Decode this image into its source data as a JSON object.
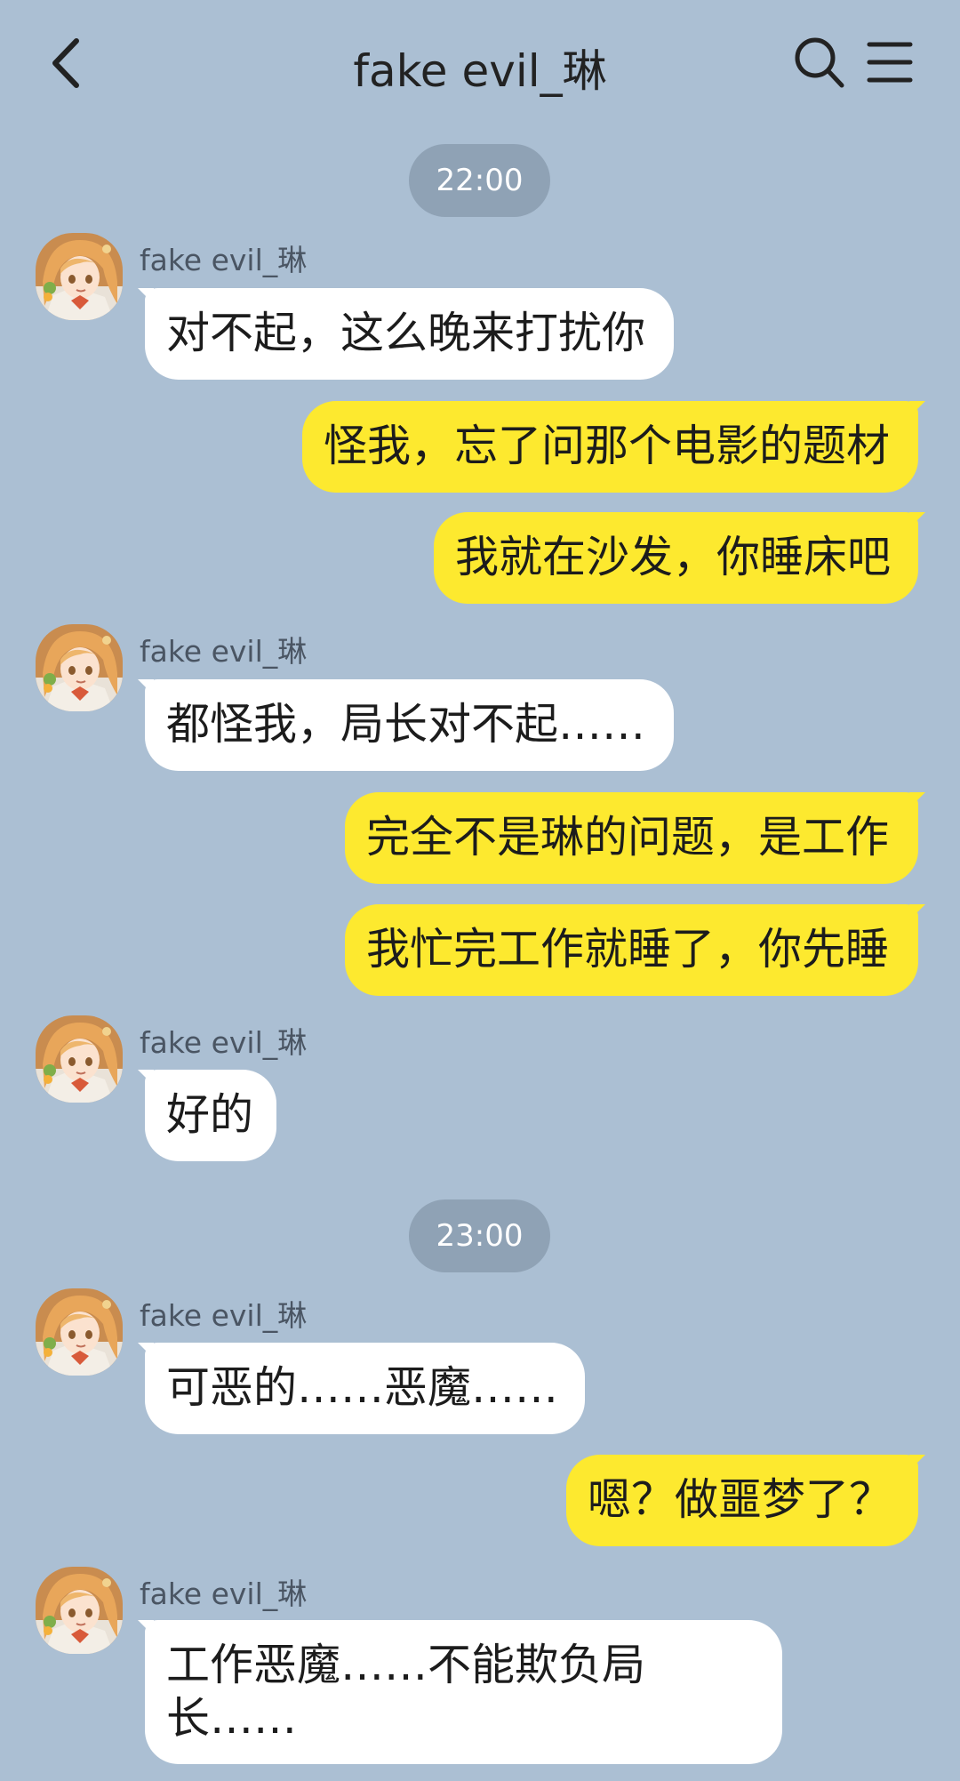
{
  "header": {
    "title": "fake evil_琳",
    "back_icon": "chevron-left-icon",
    "search_icon": "search-icon",
    "menu_icon": "hamburger-menu-icon"
  },
  "colors": {
    "background": "#abbfd3",
    "incoming_bubble": "#ffffff",
    "outgoing_bubble": "#fde92f",
    "time_pill": "#8fa2b5"
  },
  "chat": {
    "time_1": "22:00",
    "time_2": "23:00",
    "sender_name": "fake evil_琳",
    "messages": [
      {
        "from": "them",
        "text": "对不起，这么晚来打扰你"
      },
      {
        "from": "me",
        "text": "怪我，忘了问那个电影的题材"
      },
      {
        "from": "me",
        "text": "我就在沙发，你睡床吧"
      },
      {
        "from": "them",
        "text": "都怪我，局长对不起……"
      },
      {
        "from": "me",
        "text": "完全不是琳的问题，是工作"
      },
      {
        "from": "me",
        "text": "我忙完工作就睡了，你先睡"
      },
      {
        "from": "them",
        "text": "好的"
      },
      {
        "from": "them",
        "text": "可恶的……恶魔……"
      },
      {
        "from": "me",
        "text": "嗯？做噩梦了？"
      },
      {
        "from": "them",
        "text": "工作恶魔……不能欺负局长……"
      }
    ]
  }
}
